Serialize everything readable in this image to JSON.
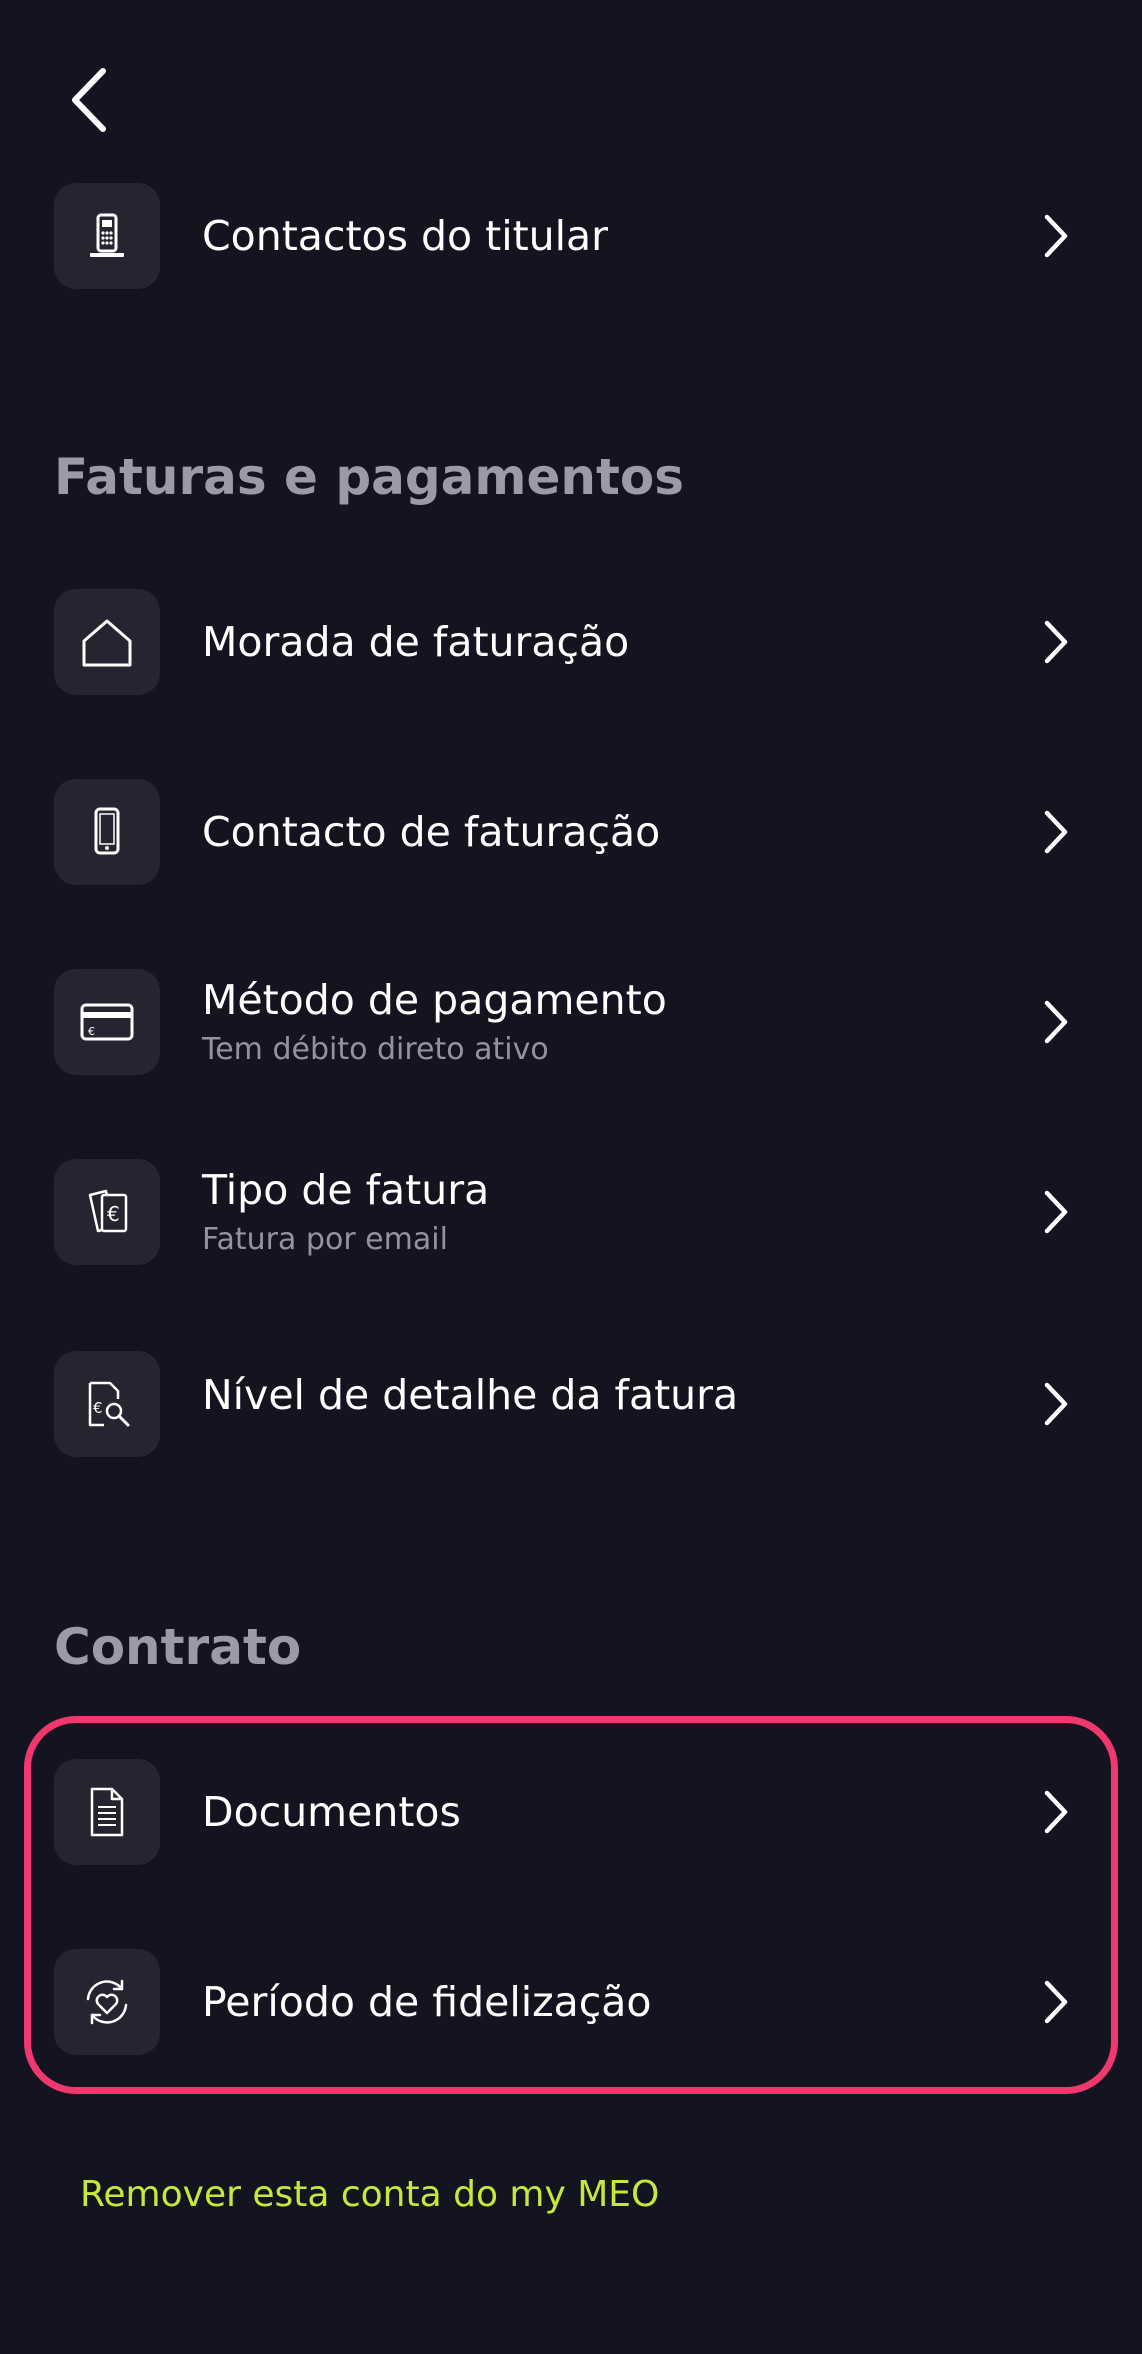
{
  "header": {
    "back_icon": "chevron-left-icon"
  },
  "top_item": {
    "label": "Contactos do titular",
    "icon": "landline-phone-icon"
  },
  "billing": {
    "title": "Faturas e pagamentos",
    "items": [
      {
        "label": "Morada de faturação",
        "subtitle": "",
        "icon": "house-icon"
      },
      {
        "label": "Contacto de faturação",
        "subtitle": "",
        "icon": "mobile-phone-icon"
      },
      {
        "label": "Método de pagamento",
        "subtitle": "Tem débito direto ativo",
        "icon": "credit-card-icon"
      },
      {
        "label": "Tipo de fatura",
        "subtitle": "Fatura por email",
        "icon": "euro-invoice-icon"
      },
      {
        "label": "Nível de detalhe da fatura",
        "subtitle": "",
        "icon": "invoice-search-icon"
      }
    ]
  },
  "contract": {
    "title": "Contrato",
    "items": [
      {
        "label": "Documentos",
        "icon": "document-icon"
      },
      {
        "label": "Período de fidelização",
        "icon": "heart-refresh-icon"
      }
    ]
  },
  "footer": {
    "remove_account": "Remover esta conta do my MEO"
  },
  "colors": {
    "background": "#141421",
    "icon_box": "#252532",
    "section_title": "#9a9aa8",
    "subtitle": "#9393a0",
    "highlight": "#f0386e",
    "link": "#c6e83a"
  }
}
